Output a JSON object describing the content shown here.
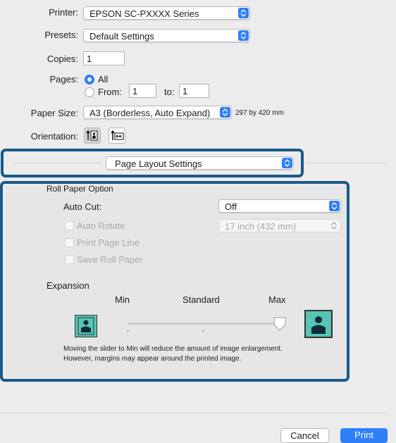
{
  "printer": {
    "label": "Printer:",
    "value": "EPSON SC-PXXXX Series"
  },
  "presets": {
    "label": "Presets:",
    "value": "Default Settings"
  },
  "copies": {
    "label": "Copies:",
    "value": "1"
  },
  "pages": {
    "label": "Pages:",
    "all_label": "All",
    "from_label": "From:",
    "from_value": "1",
    "to_label": "to:",
    "to_value": "1",
    "selected": "All"
  },
  "paper_size": {
    "label": "Paper Size:",
    "value": "A3 (Borderless, Auto Expand)",
    "dimensions": "297 by 420 mm"
  },
  "orientation": {
    "label": "Orientation:",
    "selected": "portrait"
  },
  "panel_select": {
    "value": "Page Layout Settings"
  },
  "roll_paper": {
    "section_label": "Roll Paper Option",
    "auto_cut_label": "Auto Cut:",
    "auto_cut_value": "Off",
    "auto_rotate_label": "Auto Rotate",
    "roll_width_value": "17 inch (432 mm)",
    "print_page_line_label": "Print Page Line",
    "save_roll_paper_label": "Save Roll Paper"
  },
  "expansion": {
    "label": "Expansion",
    "min_label": "Min",
    "standard_label": "Standard",
    "max_label": "Max",
    "slider_value": "Max",
    "help_line1": "Moving the slider to Min will reduce the amount of image enlargement.",
    "help_line2": "However, margins may appear around the printed image."
  },
  "buttons": {
    "cancel": "Cancel",
    "print": "Print"
  },
  "colors": {
    "accent": "#2f7ff7",
    "highlight_border": "#1a5a8a",
    "thumb": "#58c5b4"
  }
}
